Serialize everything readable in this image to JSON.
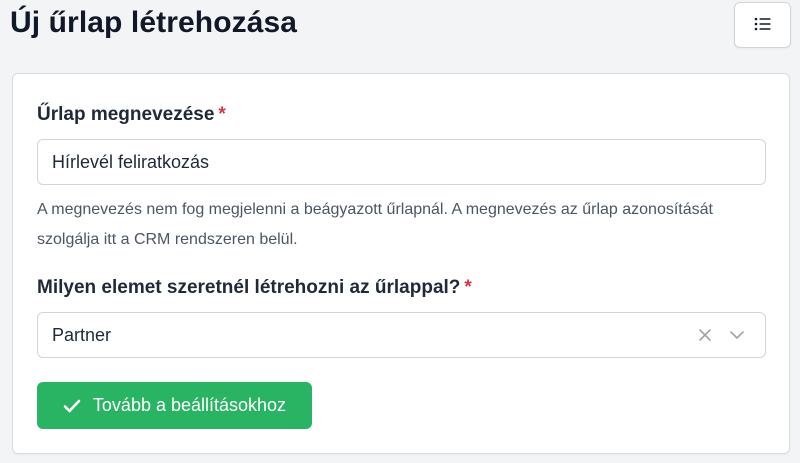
{
  "page": {
    "title": "Új űrlap létrehozása"
  },
  "header": {
    "menu_icon": "list-icon"
  },
  "form": {
    "name_field": {
      "label": "Űrlap megnevezése",
      "required_mark": "*",
      "value": "Hírlevél feliratkozás",
      "help": "A megnevezés nem fog megjelenni a beágyazott űrlapnál. A megnevezés az űrlap azonosítását szolgálja itt a CRM rendszeren belül."
    },
    "element_field": {
      "label": "Milyen elemet szeretnél létrehozni az űrlappal?",
      "required_mark": "*",
      "selected": "Partner",
      "clear_icon": "close-icon",
      "arrow_icon": "chevron-down-icon"
    },
    "submit": {
      "label": "Tovább a beállításokhoz",
      "icon": "check-icon"
    }
  },
  "colors": {
    "accent_green": "#28b463",
    "required_red": "#dc3545",
    "background": "#f3f4f6"
  }
}
